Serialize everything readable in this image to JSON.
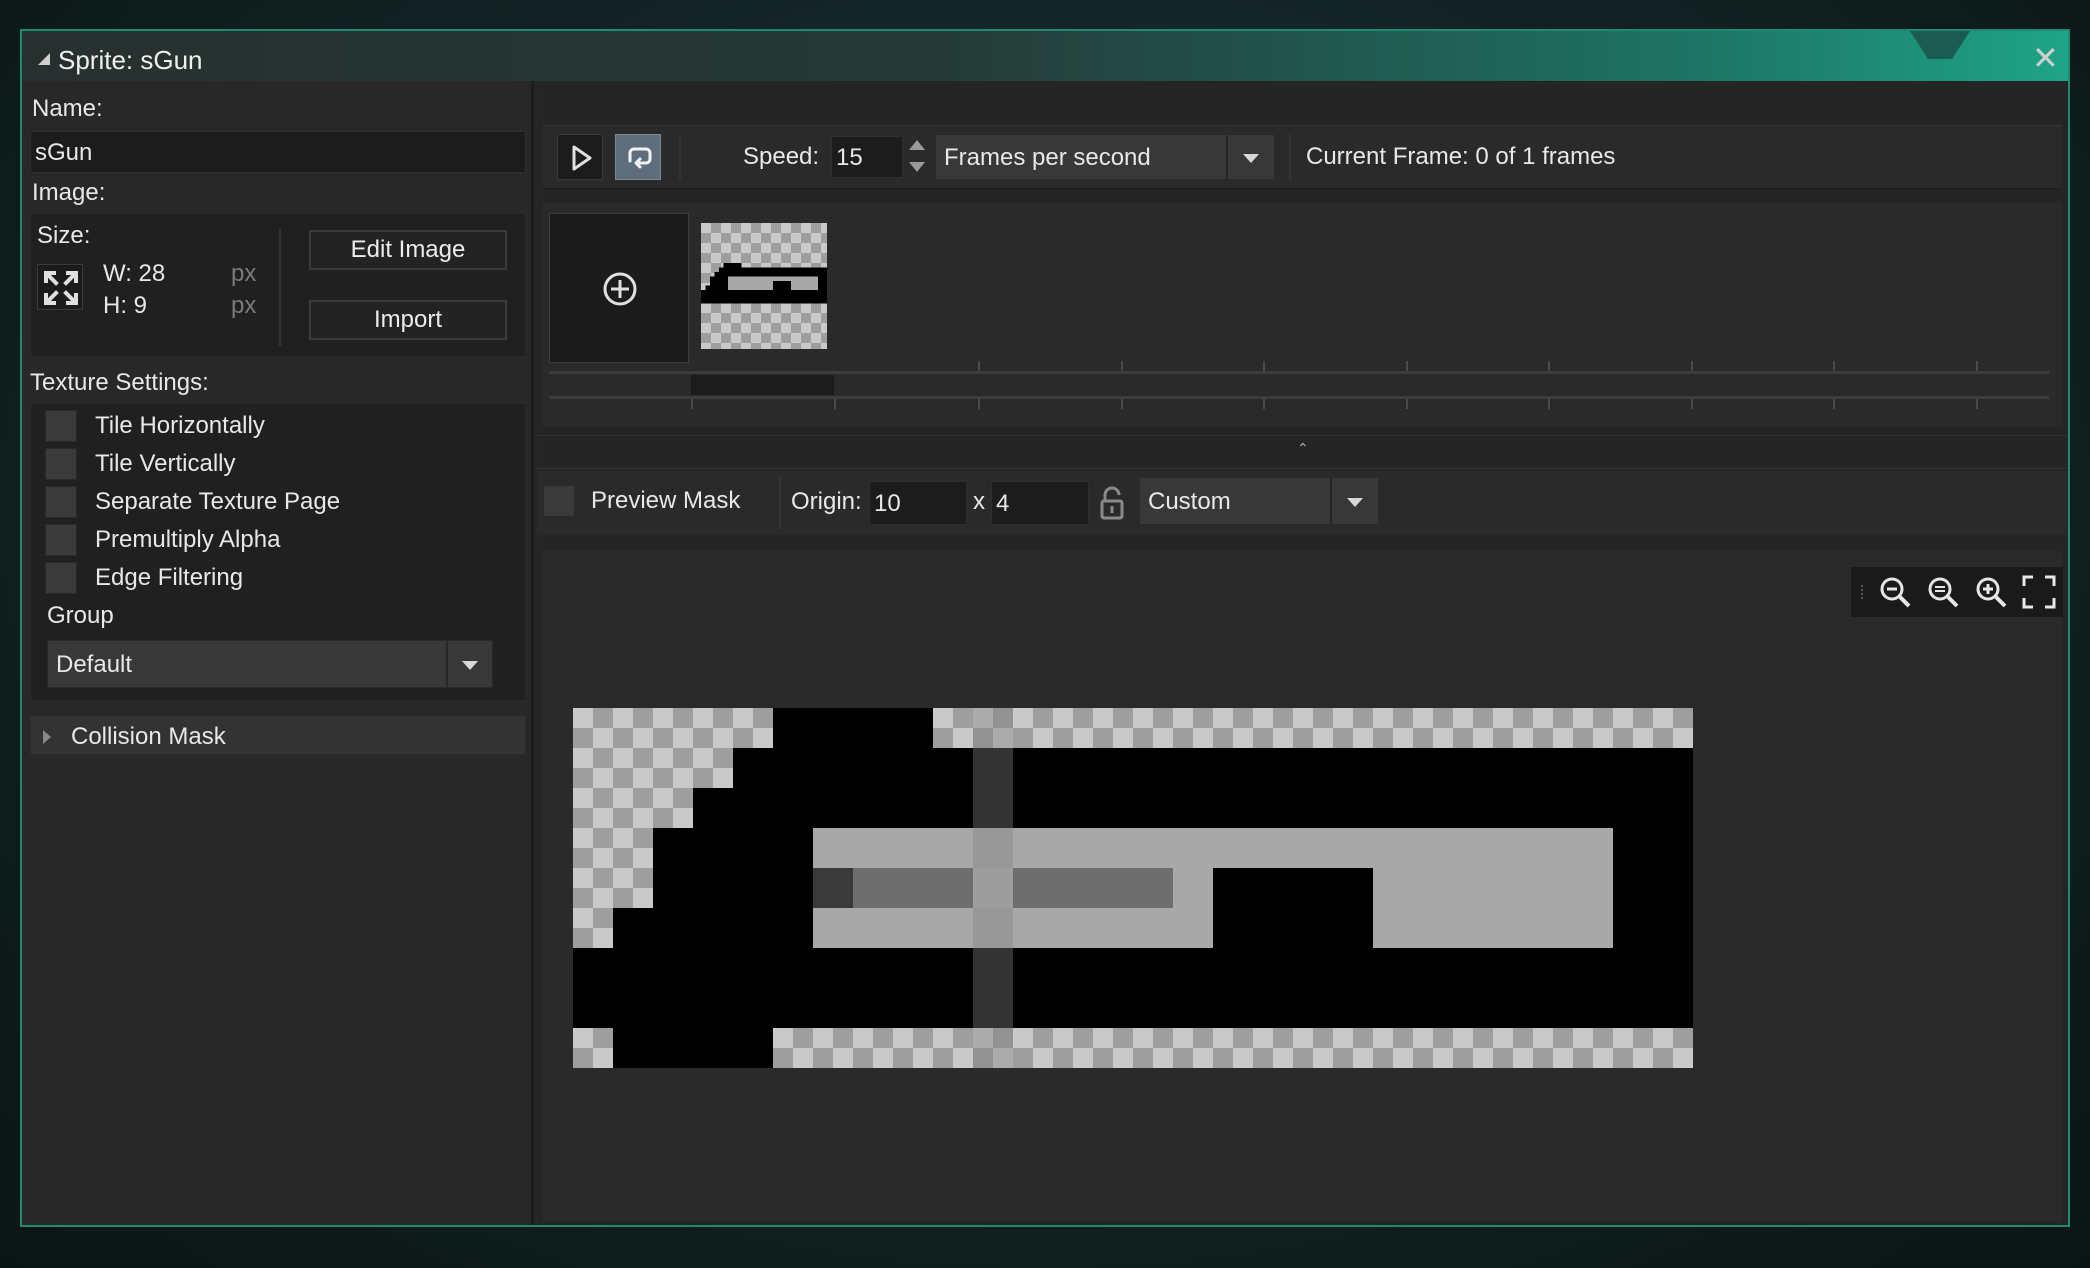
{
  "window": {
    "title": "Sprite: sGun"
  },
  "name_section": {
    "label": "Name:",
    "value": "sGun"
  },
  "image_section": {
    "label": "Image:",
    "size_label": "Size:",
    "width": "W: 28",
    "height": "H: 9",
    "unit": "px",
    "edit_image_label": "Edit Image",
    "import_label": "Import"
  },
  "texture_settings": {
    "label": "Texture Settings:",
    "options": [
      {
        "label": "Tile Horizontally",
        "checked": false
      },
      {
        "label": "Tile Vertically",
        "checked": false
      },
      {
        "label": "Separate Texture Page",
        "checked": false
      },
      {
        "label": "Premultiply Alpha",
        "checked": false
      },
      {
        "label": "Edge Filtering",
        "checked": false
      }
    ],
    "group_label": "Group",
    "group_value": "Default"
  },
  "collision_mask": {
    "label": "Collision Mask"
  },
  "playback": {
    "speed_label": "Speed:",
    "speed_value": "15",
    "speed_unit": "Frames per second",
    "current_frame_label": "Current Frame: 0 of 1 frames"
  },
  "origin": {
    "preview_mask_label": "Preview Mask",
    "label": "Origin:",
    "x": "10",
    "separator": "x",
    "y": "4",
    "preset": "Custom"
  },
  "colors": {
    "accent": "#1ea487",
    "panel": "#262626"
  }
}
